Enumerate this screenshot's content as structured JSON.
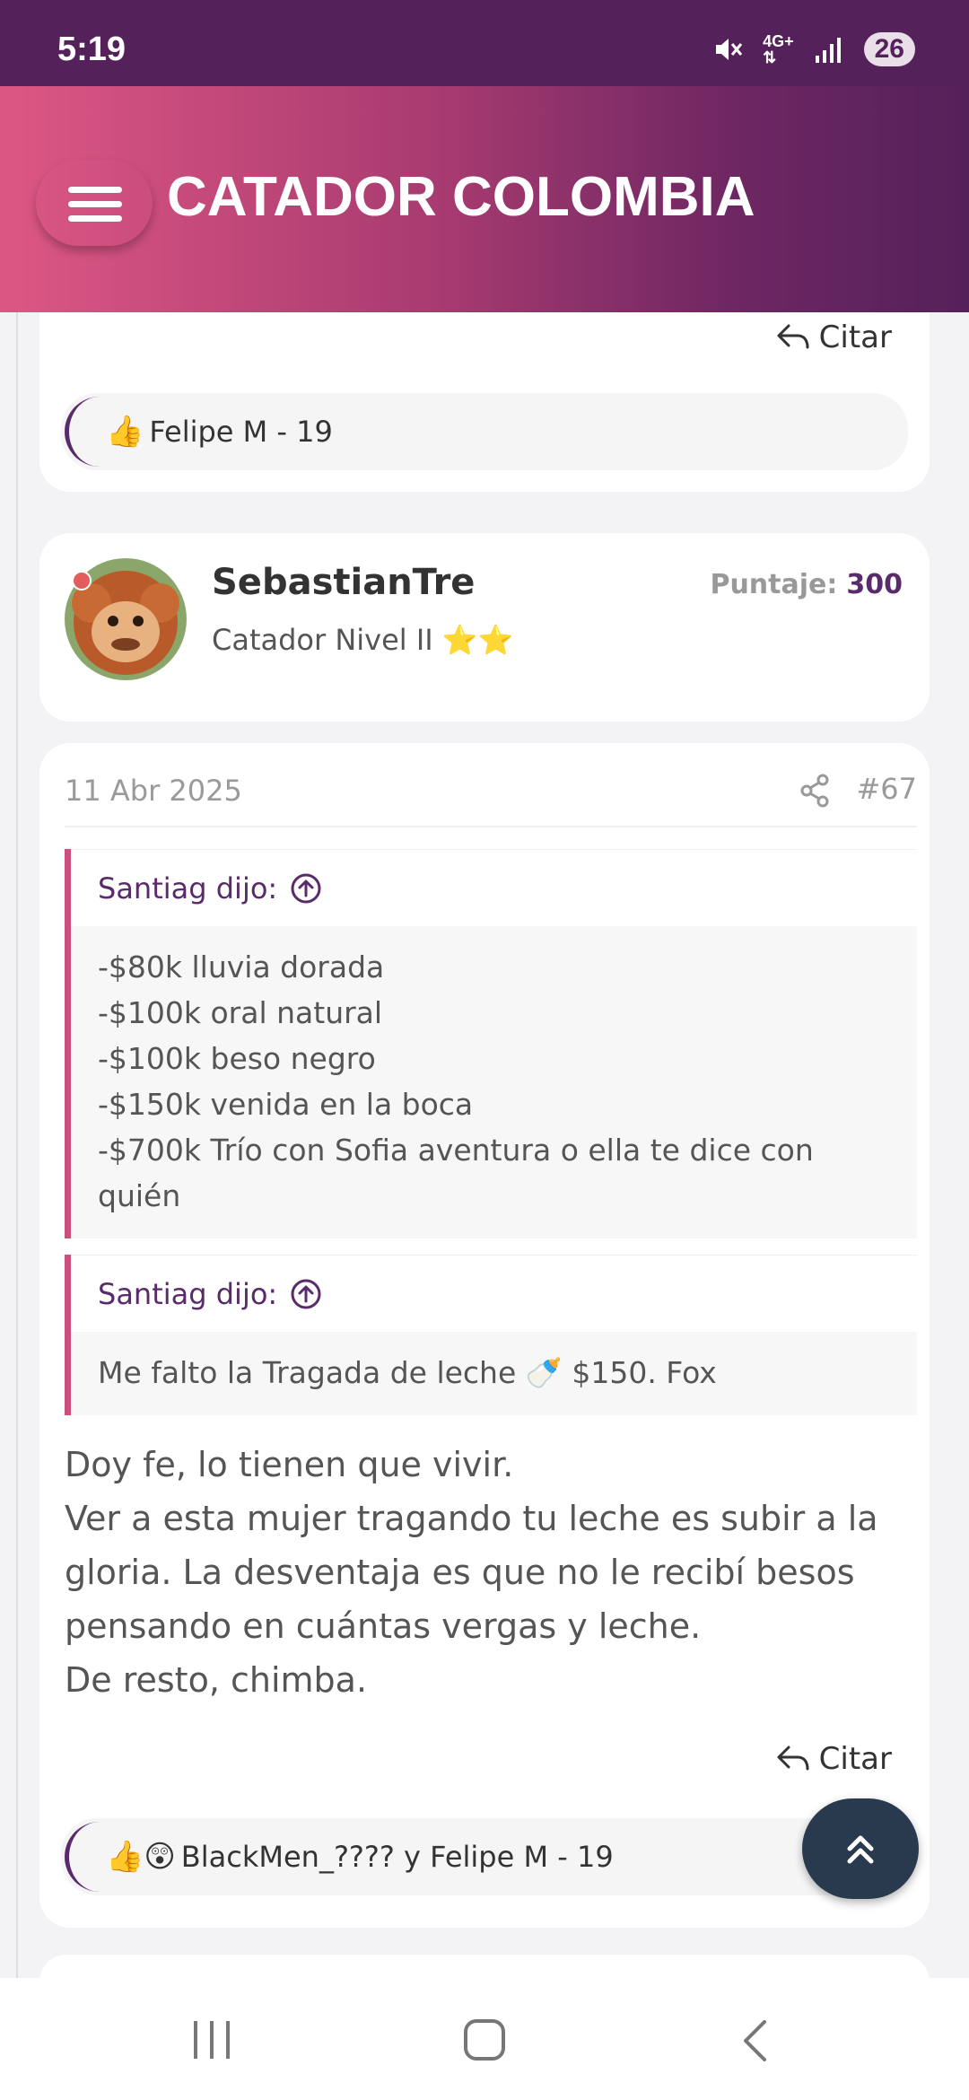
{
  "status": {
    "time": "5:19",
    "network": "4G+",
    "battery": "26",
    "icons": [
      "mute-icon",
      "network-4g-icon",
      "signal-icon",
      "battery-icon"
    ]
  },
  "header": {
    "title": "CATADOR COLOMBIA",
    "gradient_colors": [
      "#dd5784",
      "#55215a"
    ]
  },
  "prev_post": {
    "cite_label": "Citar",
    "reactions": {
      "emojis": "👍",
      "text": "Felipe M - 19"
    }
  },
  "author": {
    "username": "SebastianTre",
    "rank": "Catador Nivel II",
    "rank_stars": "⭐⭐",
    "score_label": "Puntaje:",
    "score_value": "300"
  },
  "post": {
    "date": "11 Abr 2025",
    "number": "#67",
    "quotes": [
      {
        "author": "Santiag dijo:",
        "lines": [
          "-$80k lluvia dorada",
          "-$100k oral natural",
          "-$100k beso negro",
          "-$150k venida en la boca",
          "-$700k Trío con Sofia aventura o ella te dice con quién"
        ]
      },
      {
        "author": "Santiag dijo:",
        "lines": [
          "Me falto la Tragada de leche 🍼 $150. Fox"
        ]
      }
    ],
    "body_lines": [
      "Doy fe, lo tienen que vivir.",
      "Ver a esta mujer tragando tu leche es subir a la gloria. La desventaja es que no le recibí besos pensando en cuántas vergas y leche.",
      "De resto, chimba."
    ],
    "cite_label": "Citar",
    "reactions": {
      "emojis": "👍😲",
      "text": "BlackMen_???? y Felipe M - 19"
    }
  },
  "colors": {
    "accent": "#5a2b6b",
    "quote_border": "#c94f7c",
    "scroll_top_bg": "#2a3a4e"
  }
}
